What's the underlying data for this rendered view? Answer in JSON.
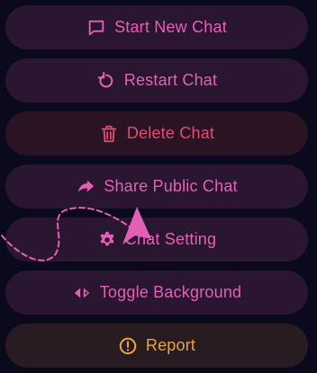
{
  "menu": {
    "items": [
      {
        "label": "Start New Chat",
        "icon": "chat-bubble-icon",
        "color": "#e55fb6"
      },
      {
        "label": "Restart Chat",
        "icon": "restart-icon",
        "color": "#e55fb6"
      },
      {
        "label": "Delete Chat",
        "icon": "trash-icon",
        "color": "#e24c70"
      },
      {
        "label": "Share Public Chat",
        "icon": "share-arrow-icon",
        "color": "#e55fb6"
      },
      {
        "label": "Chat Setting",
        "icon": "gear-icon",
        "color": "#e55fb6"
      },
      {
        "label": "Toggle Background",
        "icon": "toggle-arrows-icon",
        "color": "#e55fb6"
      },
      {
        "label": "Report",
        "icon": "alert-circle-icon",
        "color": "#e9a53b"
      }
    ]
  },
  "colors": {
    "background": "#0b0a1c",
    "accent_pink": "#e55fb6",
    "danger_red": "#e24c70",
    "warning_gold": "#e9a53b"
  }
}
